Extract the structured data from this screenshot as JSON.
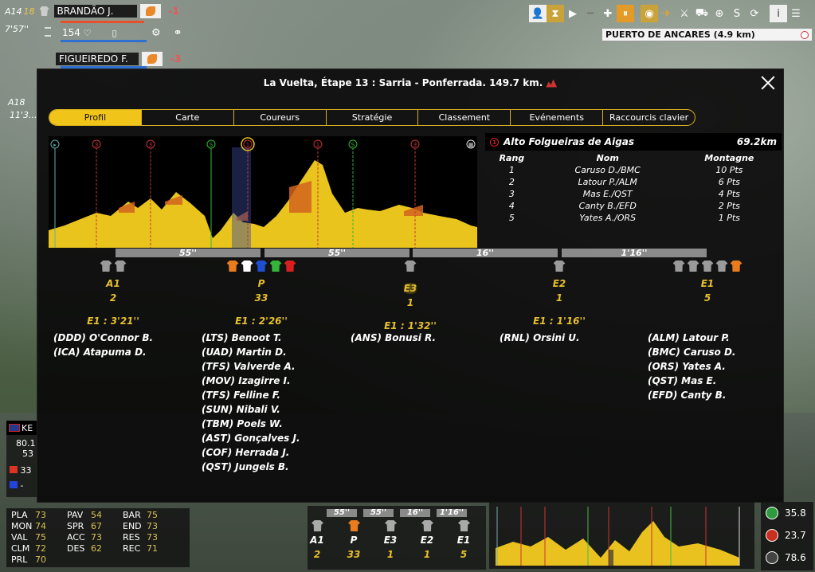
{
  "hud": {
    "group1": {
      "label": "A14",
      "number": "18",
      "time": "7'57''"
    },
    "rider1": {
      "name": "BRANDÃO J.",
      "delta": "-1",
      "energy": "154"
    },
    "rider2": {
      "name": "FIGUEIREDO F.",
      "delta": "-3"
    },
    "group2": {
      "label": "A18",
      "time": "11'3..."
    },
    "location": "PUERTO DE ANCARES (4.9 km)",
    "toolbar_icons": [
      "rider-icon",
      "hourglass-icon",
      "play-icon",
      "minus-icon",
      "plus-icon",
      "pause-icon",
      "eye-icon",
      "plane-icon",
      "helicopter-icon",
      "car-icon",
      "target-icon",
      "sprint-icon",
      "refresh-icon",
      "info-icon",
      "menu-icon"
    ]
  },
  "dialog": {
    "title": "La Vuelta, Étape 13 : Sarria - Ponferrada. 149.7 km.",
    "tabs": [
      "Profil",
      "Carte",
      "Coureurs",
      "Stratégie",
      "Classement",
      "Evénements",
      "Raccourcis clavier"
    ],
    "active_tab": 0,
    "climb": {
      "category": "1",
      "name": "Alto Folgueiras de Aigas",
      "distance": "69.2km",
      "columns": [
        "Rang",
        "Nom",
        "Montagne"
      ],
      "rows": [
        [
          "1",
          "Caruso D./BMC",
          "10 Pts"
        ],
        [
          "2",
          "Latour P./ALM",
          "6 Pts"
        ],
        [
          "3",
          "Mas E./QST",
          "4 Pts"
        ],
        [
          "4",
          "Canty B./EFD",
          "2 Pts"
        ],
        [
          "5",
          "Yates A./ORS",
          "1 Pts"
        ]
      ]
    },
    "profile_markers": [
      "▸",
      "3",
      "3",
      "S",
      "1",
      "1",
      "S",
      "3",
      "finish"
    ],
    "gaps": [
      "55''",
      "55''",
      "16''",
      "1'16''"
    ],
    "groups": [
      {
        "label": "A1",
        "count": "2",
        "time": "E1 : 3'21''",
        "shirts": [
          "#9a9a9a",
          "#9a9a9a"
        ],
        "riders": [
          "(DDD) O'Connor B.",
          "(ICA) Atapuma D."
        ]
      },
      {
        "label": "P",
        "count": "33",
        "time": "E1 : 2'26''",
        "shirts": [
          "#e87c1e",
          "#ffffff",
          "#1f4fd1",
          "#35b33a",
          "#d62020"
        ],
        "riders": [
          "(LTS) Benoot T.",
          "(UAD) Martin D.",
          "(TFS) Valverde A.",
          "(MOV) Izagirre I.",
          "(TFS) Felline F.",
          "(SUN) Nibali V.",
          "(TBM) Poels W.",
          "(AST) Gonçalves J.",
          "(COF) Herrada J.",
          "(QST) Jungels B."
        ]
      },
      {
        "label": "E3",
        "count": "1",
        "time": "E1 : 1'32''",
        "shirts": [
          "#9a9a9a"
        ],
        "riders": [
          "(ANS) Bonusi R."
        ]
      },
      {
        "label": "E2",
        "count": "1",
        "time": "E1 : 1'16''",
        "shirts": [
          "#9a9a9a"
        ],
        "riders": [
          "(RNL) Orsini U."
        ]
      },
      {
        "label": "E1",
        "count": "5",
        "time": "",
        "shirts": [
          "#9a9a9a",
          "#9a9a9a",
          "#9a9a9a",
          "#9a9a9a",
          "#e87c1e"
        ],
        "riders": [
          "(ALM) Latour P.",
          "(BMC) Caruso D.",
          "(ORS) Yates A.",
          "(QST) Mas E.",
          "(EFD) Canty B."
        ]
      }
    ]
  },
  "stats": {
    "col1": [
      [
        "PLA",
        "73"
      ],
      [
        "MON",
        "74"
      ],
      [
        "VAL",
        "75"
      ],
      [
        "CLM",
        "72"
      ],
      [
        "PRL",
        "70"
      ]
    ],
    "col2": [
      [
        "PAV",
        "54"
      ],
      [
        "SPR",
        "67"
      ],
      [
        "ACC",
        "73"
      ],
      [
        "DES",
        "62"
      ]
    ],
    "col3": [
      [
        "BAR",
        "75"
      ],
      [
        "END",
        "73"
      ],
      [
        "RES",
        "73"
      ],
      [
        "REC",
        "71"
      ]
    ]
  },
  "left_panel": {
    "flag_text": "KE",
    "v1": "80.1",
    "v2": "53",
    "v3": "33",
    "v4": "-"
  },
  "mini": {
    "gaps": [
      "55''",
      "55''",
      "16''",
      "1'16''"
    ],
    "labels": [
      "A1",
      "P",
      "E3",
      "E2",
      "E1"
    ],
    "counts": [
      "2",
      "33",
      "1",
      "1",
      "5"
    ]
  },
  "summary": [
    {
      "icon": "sprint-icon",
      "value": "35.8",
      "color": "#2f9b3f"
    },
    {
      "icon": "climb-icon",
      "value": "23.7",
      "color": "#c8311f"
    },
    {
      "icon": "finish-icon",
      "value": "78.6",
      "color": "#444444"
    }
  ]
}
